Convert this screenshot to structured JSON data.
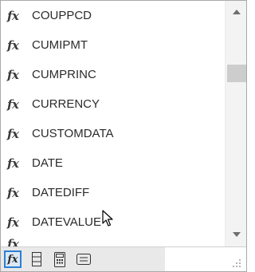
{
  "icons": {
    "function": "fx"
  },
  "functions": [
    {
      "name": "COUPPCD"
    },
    {
      "name": "CUMIPMT"
    },
    {
      "name": "CUMPRINC"
    },
    {
      "name": "CURRENCY"
    },
    {
      "name": "CUSTOMDATA"
    },
    {
      "name": "DATE"
    },
    {
      "name": "DATEDIFF"
    },
    {
      "name": "DATEVALUE"
    }
  ],
  "toolbar": {
    "buttons": [
      {
        "icon": "function-icon",
        "active": true
      },
      {
        "icon": "table-icon",
        "active": false
      },
      {
        "icon": "calculator-icon",
        "active": false
      },
      {
        "icon": "text-icon",
        "active": false
      }
    ]
  },
  "colors": {
    "accent": "#2d7fd3",
    "scroll_thumb": "#cdcdcd",
    "toolbar_bg": "#e9e9e9"
  }
}
